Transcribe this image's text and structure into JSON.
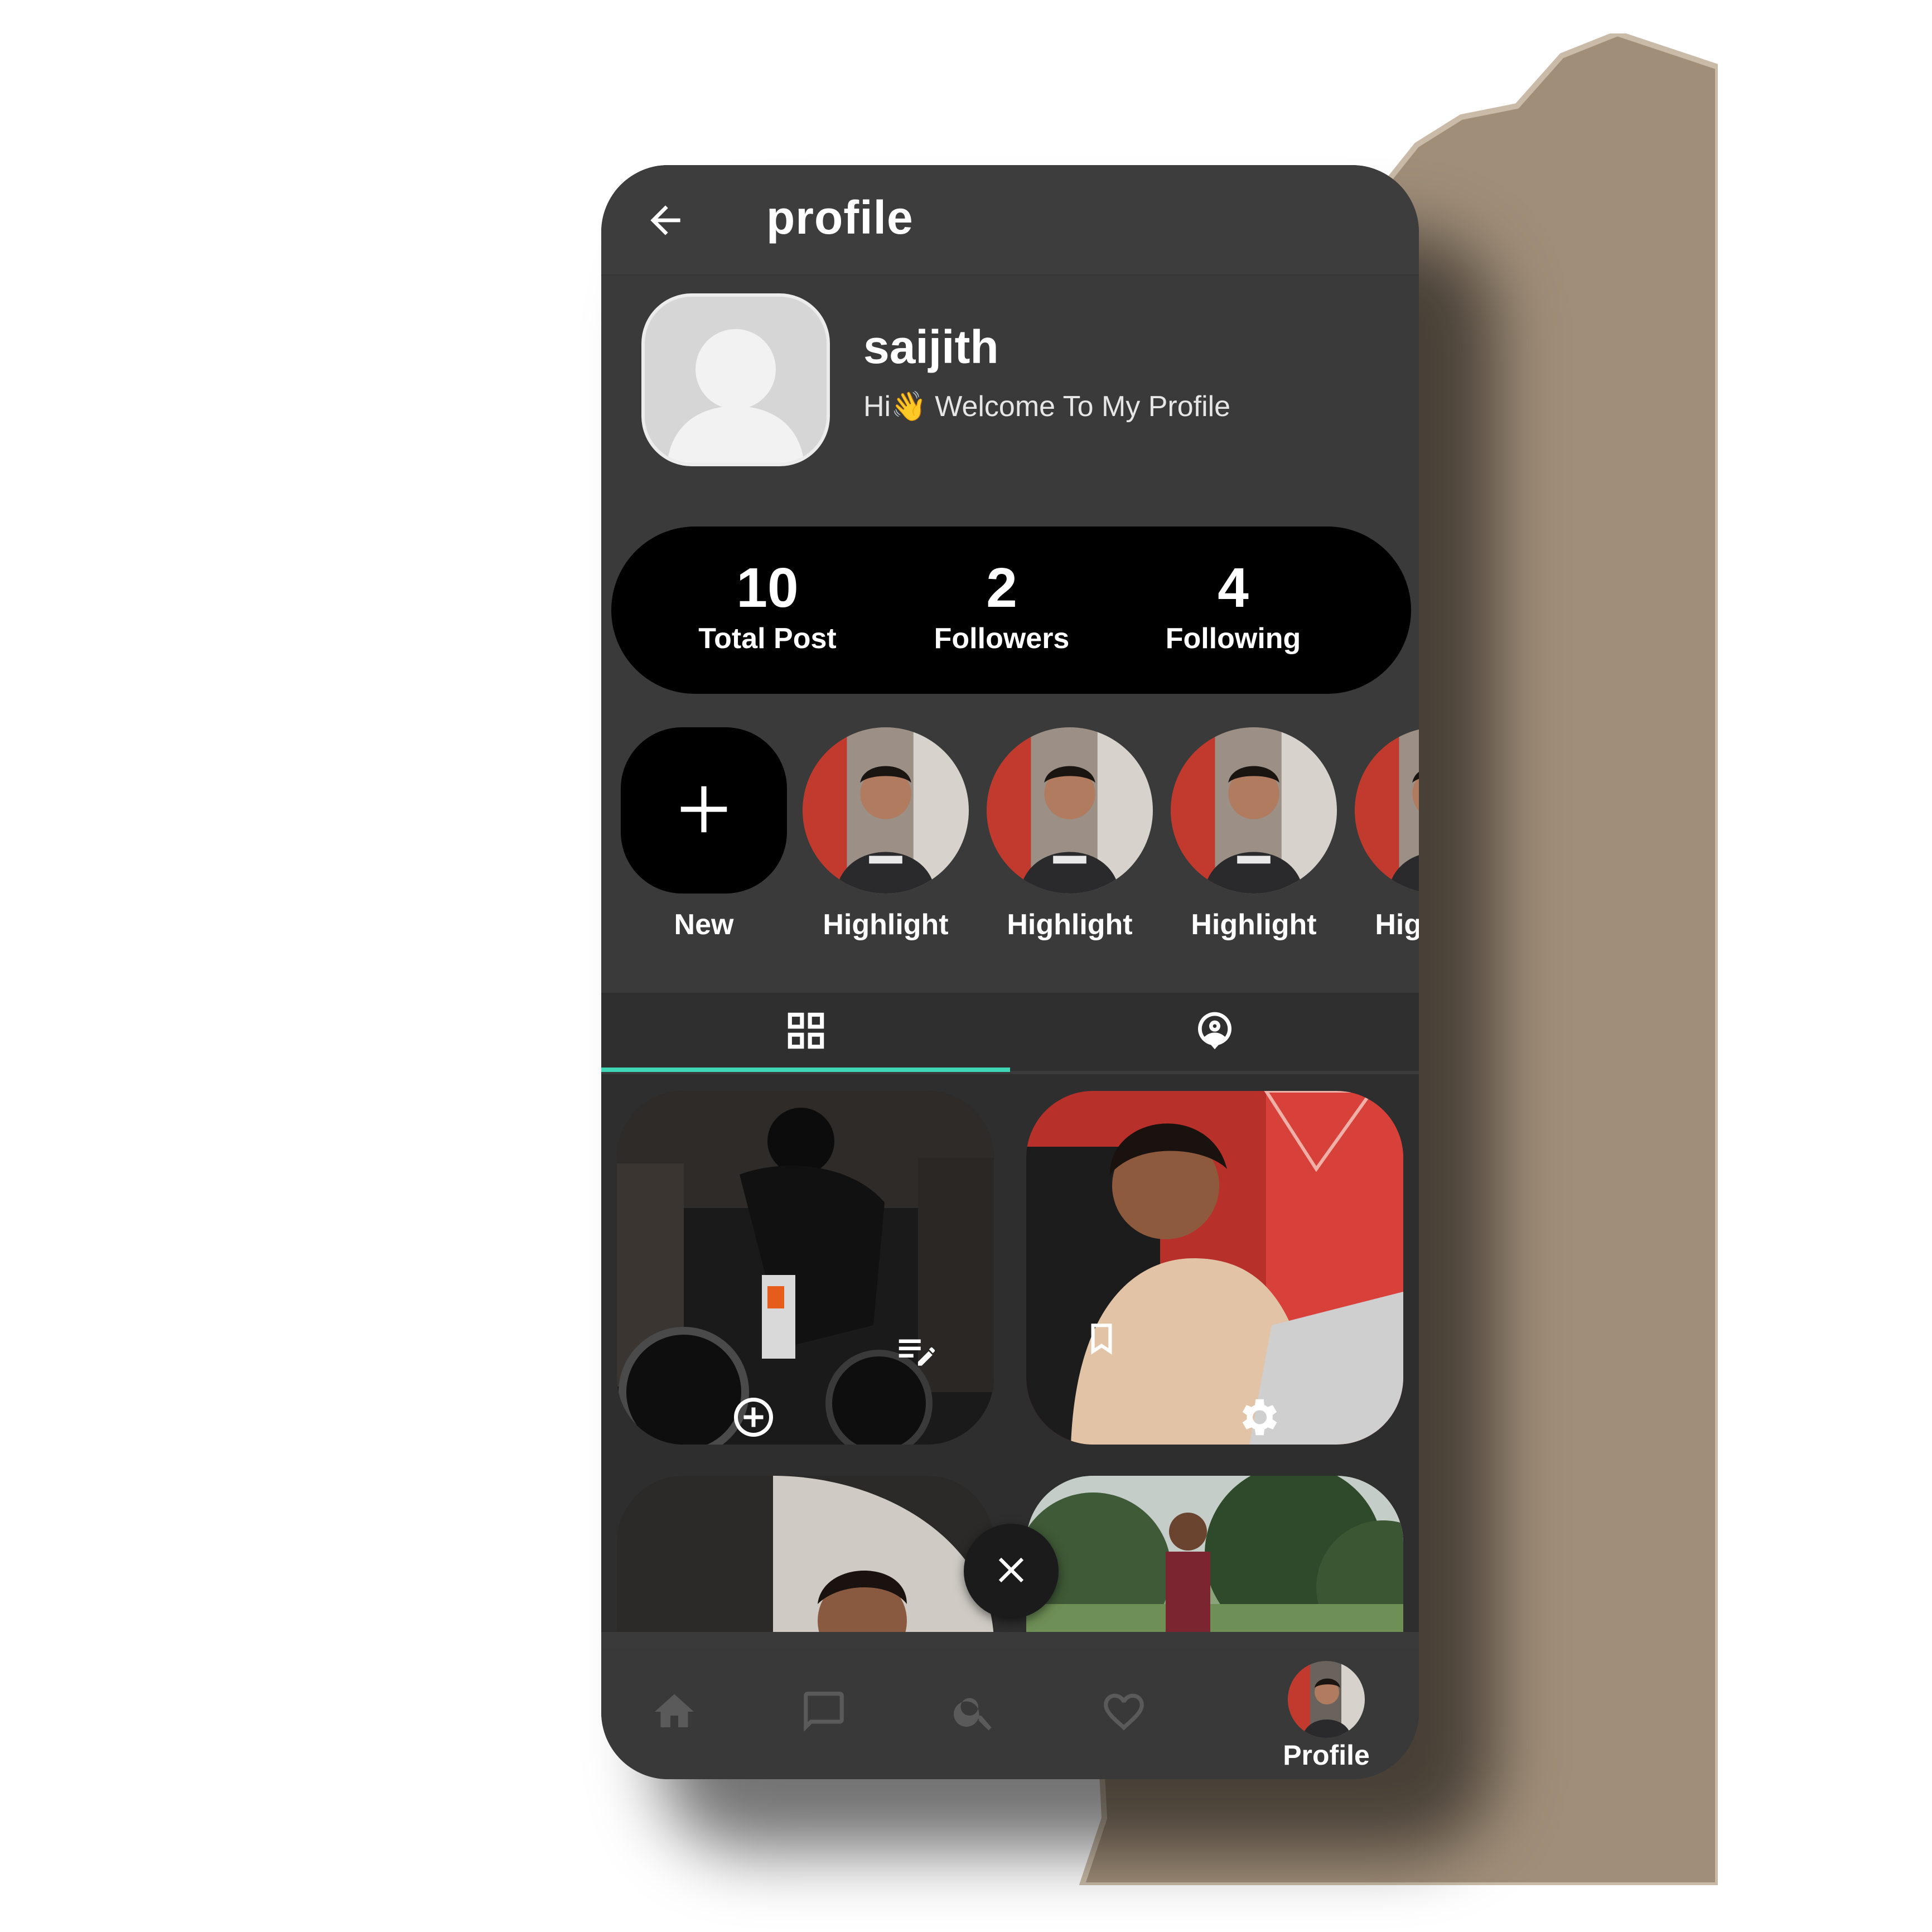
{
  "header": {
    "title": "profile"
  },
  "profile": {
    "username": "saijith",
    "bio": "Hi👋 Welcome To My Profile"
  },
  "stats": [
    {
      "value": "10",
      "label": "Total Post"
    },
    {
      "value": "2",
      "label": "Followers"
    },
    {
      "value": "4",
      "label": "Following"
    }
  ],
  "highlights": {
    "new_label": "New",
    "items": [
      {
        "label": "Highlight"
      },
      {
        "label": "Highlight"
      },
      {
        "label": "Highlight"
      },
      {
        "label": "Highlight"
      }
    ]
  },
  "tabs": {
    "active": "grid",
    "items": [
      {
        "icon": "grid-icon"
      },
      {
        "icon": "tagged-person-icon"
      }
    ],
    "accent_color": "#3fd7b8"
  },
  "posts": [
    {
      "subject": "motorcycle-rider",
      "overlay_icons": [
        "edit-list-icon",
        "add-circle-icon"
      ]
    },
    {
      "subject": "man-with-laptop",
      "overlay_icons": [
        "bookmark-icon",
        "settings-icon"
      ]
    },
    {
      "subject": "man-portrait"
    },
    {
      "subject": "man-in-field"
    }
  ],
  "bottom_nav": {
    "items": [
      {
        "icon": "home-icon"
      },
      {
        "icon": "chat-icon"
      },
      {
        "icon": "search-icon"
      },
      {
        "icon": "heart-icon"
      }
    ],
    "profile_label": "Profile"
  },
  "colors": {
    "phone_background": "#3a3a3a",
    "stats_background": "#000000",
    "tab_indicator": "#3fd7b8",
    "paper": "#9b8a76"
  }
}
